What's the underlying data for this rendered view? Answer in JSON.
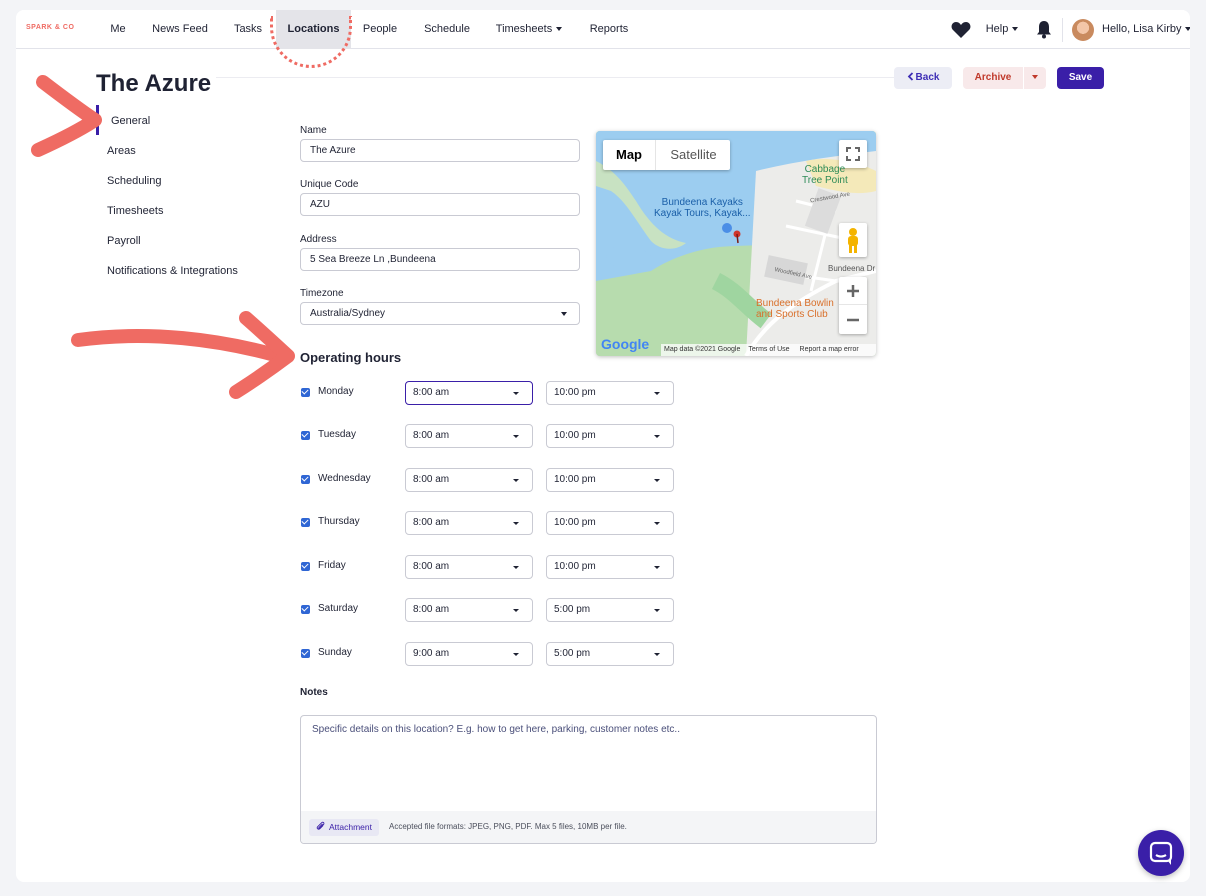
{
  "nav": {
    "brand": "SPARK & CO",
    "items": [
      "Me",
      "News Feed",
      "Tasks",
      "Locations",
      "People",
      "Schedule",
      "Timesheets",
      "Reports"
    ],
    "help": "Help",
    "greeting": "Hello, Lisa Kirby"
  },
  "header": {
    "title": "The Azure",
    "back": "Back",
    "archive": "Archive",
    "save": "Save"
  },
  "sidebar": {
    "items": [
      "General",
      "Areas",
      "Scheduling",
      "Timesheets",
      "Payroll",
      "Notifications & Integrations"
    ]
  },
  "form": {
    "name_label": "Name",
    "name_value": "The Azure",
    "code_label": "Unique Code",
    "code_value": "AZU",
    "address_label": "Address",
    "address_value": "5 Sea Breeze Ln ,Bundeena",
    "timezone_label": "Timezone",
    "timezone_value": "Australia/Sydney"
  },
  "map": {
    "tab_map": "Map",
    "tab_satellite": "Satellite",
    "place_cabbage": "Cabbage",
    "place_tree_point": "Tree Point",
    "place_kayaks": "Bundeena Kayaks",
    "place_kayak_tours": "Kayak Tours, Kayak...",
    "place_bowling": "Bundeena Bowlin",
    "place_sports": "and Sports Club",
    "road_bundeena": "Bundeena Dr",
    "road_woodfield": "Woodfield Ave",
    "road_crestwood": "Crestwood Ave",
    "google": "Google",
    "footer_data": "Map data ©2021 Google",
    "footer_terms": "Terms of Use",
    "footer_report": "Report a map error"
  },
  "hours": {
    "title": "Operating hours",
    "days": [
      {
        "day": "Monday",
        "open": "8:00 am",
        "close": "10:00 pm"
      },
      {
        "day": "Tuesday",
        "open": "8:00 am",
        "close": "10:00 pm"
      },
      {
        "day": "Wednesday",
        "open": "8:00 am",
        "close": "10:00 pm"
      },
      {
        "day": "Thursday",
        "open": "8:00 am",
        "close": "10:00 pm"
      },
      {
        "day": "Friday",
        "open": "8:00 am",
        "close": "10:00 pm"
      },
      {
        "day": "Saturday",
        "open": "8:00 am",
        "close": "5:00 pm"
      },
      {
        "day": "Sunday",
        "open": "9:00 am",
        "close": "5:00 pm"
      }
    ]
  },
  "notes": {
    "label": "Notes",
    "placeholder": "Specific details on this location? E.g. how to get here, parking, customer notes etc..",
    "attachment": "Attachment",
    "hint": "Accepted file formats: JPEG, PNG, PDF. Max 5 files, 10MB per file."
  },
  "colors": {
    "accent": "#3a1fa8",
    "annotation": "#ef6b63"
  }
}
